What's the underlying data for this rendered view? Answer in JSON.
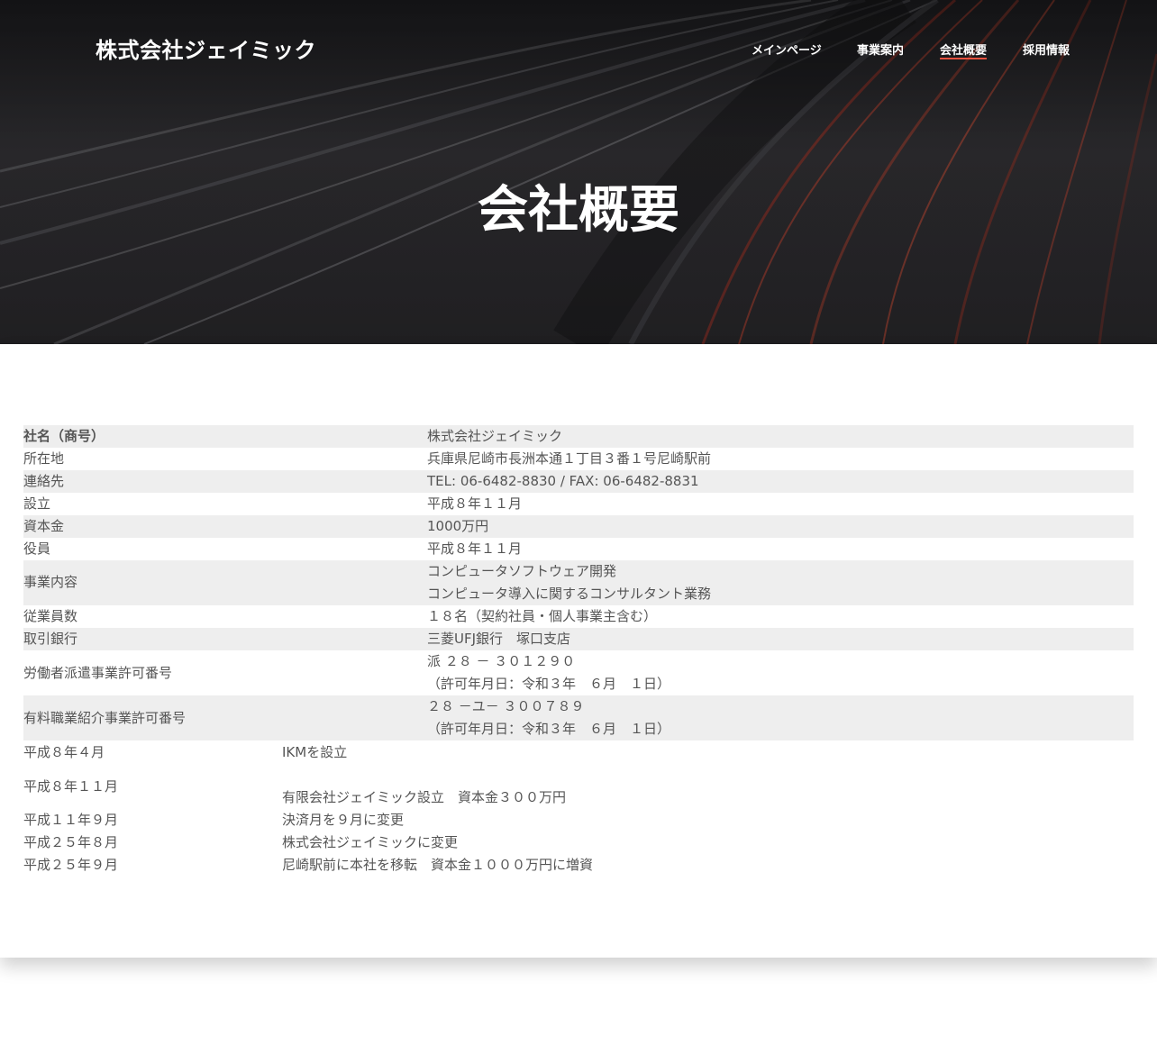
{
  "header": {
    "brand": "株式会社ジェイミック",
    "nav": [
      {
        "label": "メインページ",
        "active": false
      },
      {
        "label": "事業案内",
        "active": false
      },
      {
        "label": "会社概要",
        "active": true
      },
      {
        "label": "採用情報",
        "active": false
      }
    ],
    "accent_color": "#e9513f"
  },
  "hero": {
    "title": "会社概要"
  },
  "company_info": [
    {
      "label": "社名（商号）",
      "value": "株式会社ジェイミック"
    },
    {
      "label": "所在地",
      "value": "兵庫県尼崎市長洲本通１丁目３番１号尼崎駅前"
    },
    {
      "label": "連絡先",
      "value": "TEL: 06-6482-8830 / FAX: 06-6482-8831"
    },
    {
      "label": "設立",
      "value": "平成８年１１月"
    },
    {
      "label": "資本金",
      "value": "1000万円"
    },
    {
      "label": "役員",
      "value": "平成８年１１月"
    },
    {
      "label": "事業内容",
      "value": "コンピュータソフトウェア開発",
      "value2": "コンピュータ導入に関するコンサルタント業務"
    },
    {
      "label": "従業員数",
      "value": "１８名（契約社員・個人事業主含む）"
    },
    {
      "label": "取引銀行",
      "value": "三菱UFJ銀行　塚口支店"
    },
    {
      "label": "労働者派遣事業許可番号",
      "value": "派 ２８ － ３０１２９０",
      "value2": "（許可年月日：令和３年　６月　１日）"
    },
    {
      "label": "有料職業紹介事業許可番号",
      "value": "２８ －ユ－ ３００７８９",
      "value2": "（許可年月日：令和３年　６月　１日）"
    }
  ],
  "history": [
    {
      "date": "平成８年４月",
      "event": "IKMを設立"
    },
    {
      "date": "平成８年１１月",
      "event": "有限会社ジェイミック設立　資本金３００万円"
    },
    {
      "date": "平成１１年９月",
      "event": "決済月を９月に変更"
    },
    {
      "date": "平成２５年８月",
      "event": "株式会社ジェイミックに変更"
    },
    {
      "date": "平成２５年９月",
      "event": "尼崎駅前に本社を移転　資本金１０００万円に増資"
    }
  ]
}
